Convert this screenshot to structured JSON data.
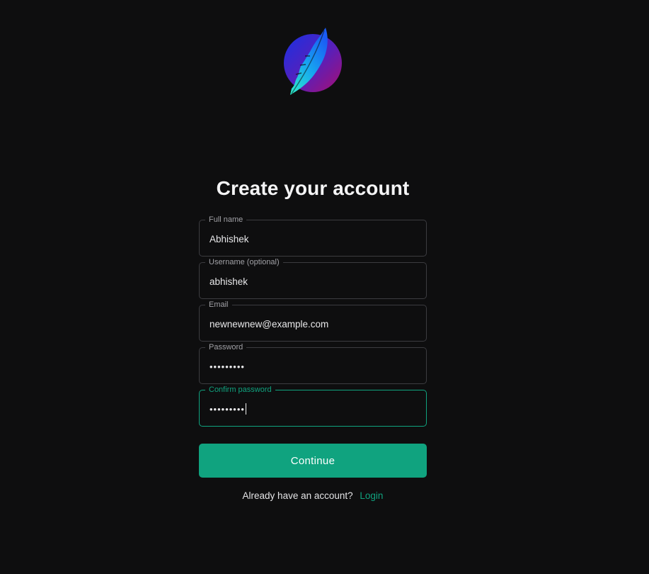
{
  "logo": {
    "name": "feather-logo"
  },
  "title": "Create your account",
  "fields": {
    "full_name": {
      "label": "Full name",
      "value": "Abhishek"
    },
    "username": {
      "label": "Username (optional)",
      "value": "abhishek"
    },
    "email": {
      "label": "Email",
      "value": "newnewnew@example.com"
    },
    "password": {
      "label": "Password",
      "value": "•••••••••"
    },
    "confirm_password": {
      "label": "Confirm password",
      "value": "•••••••••"
    }
  },
  "continue_label": "Continue",
  "footer": {
    "prompt": "Already have an account?",
    "login_label": "Login"
  },
  "colors": {
    "background": "#0e0e0f",
    "accent": "#10a37f",
    "field_border": "#3c3c40"
  }
}
